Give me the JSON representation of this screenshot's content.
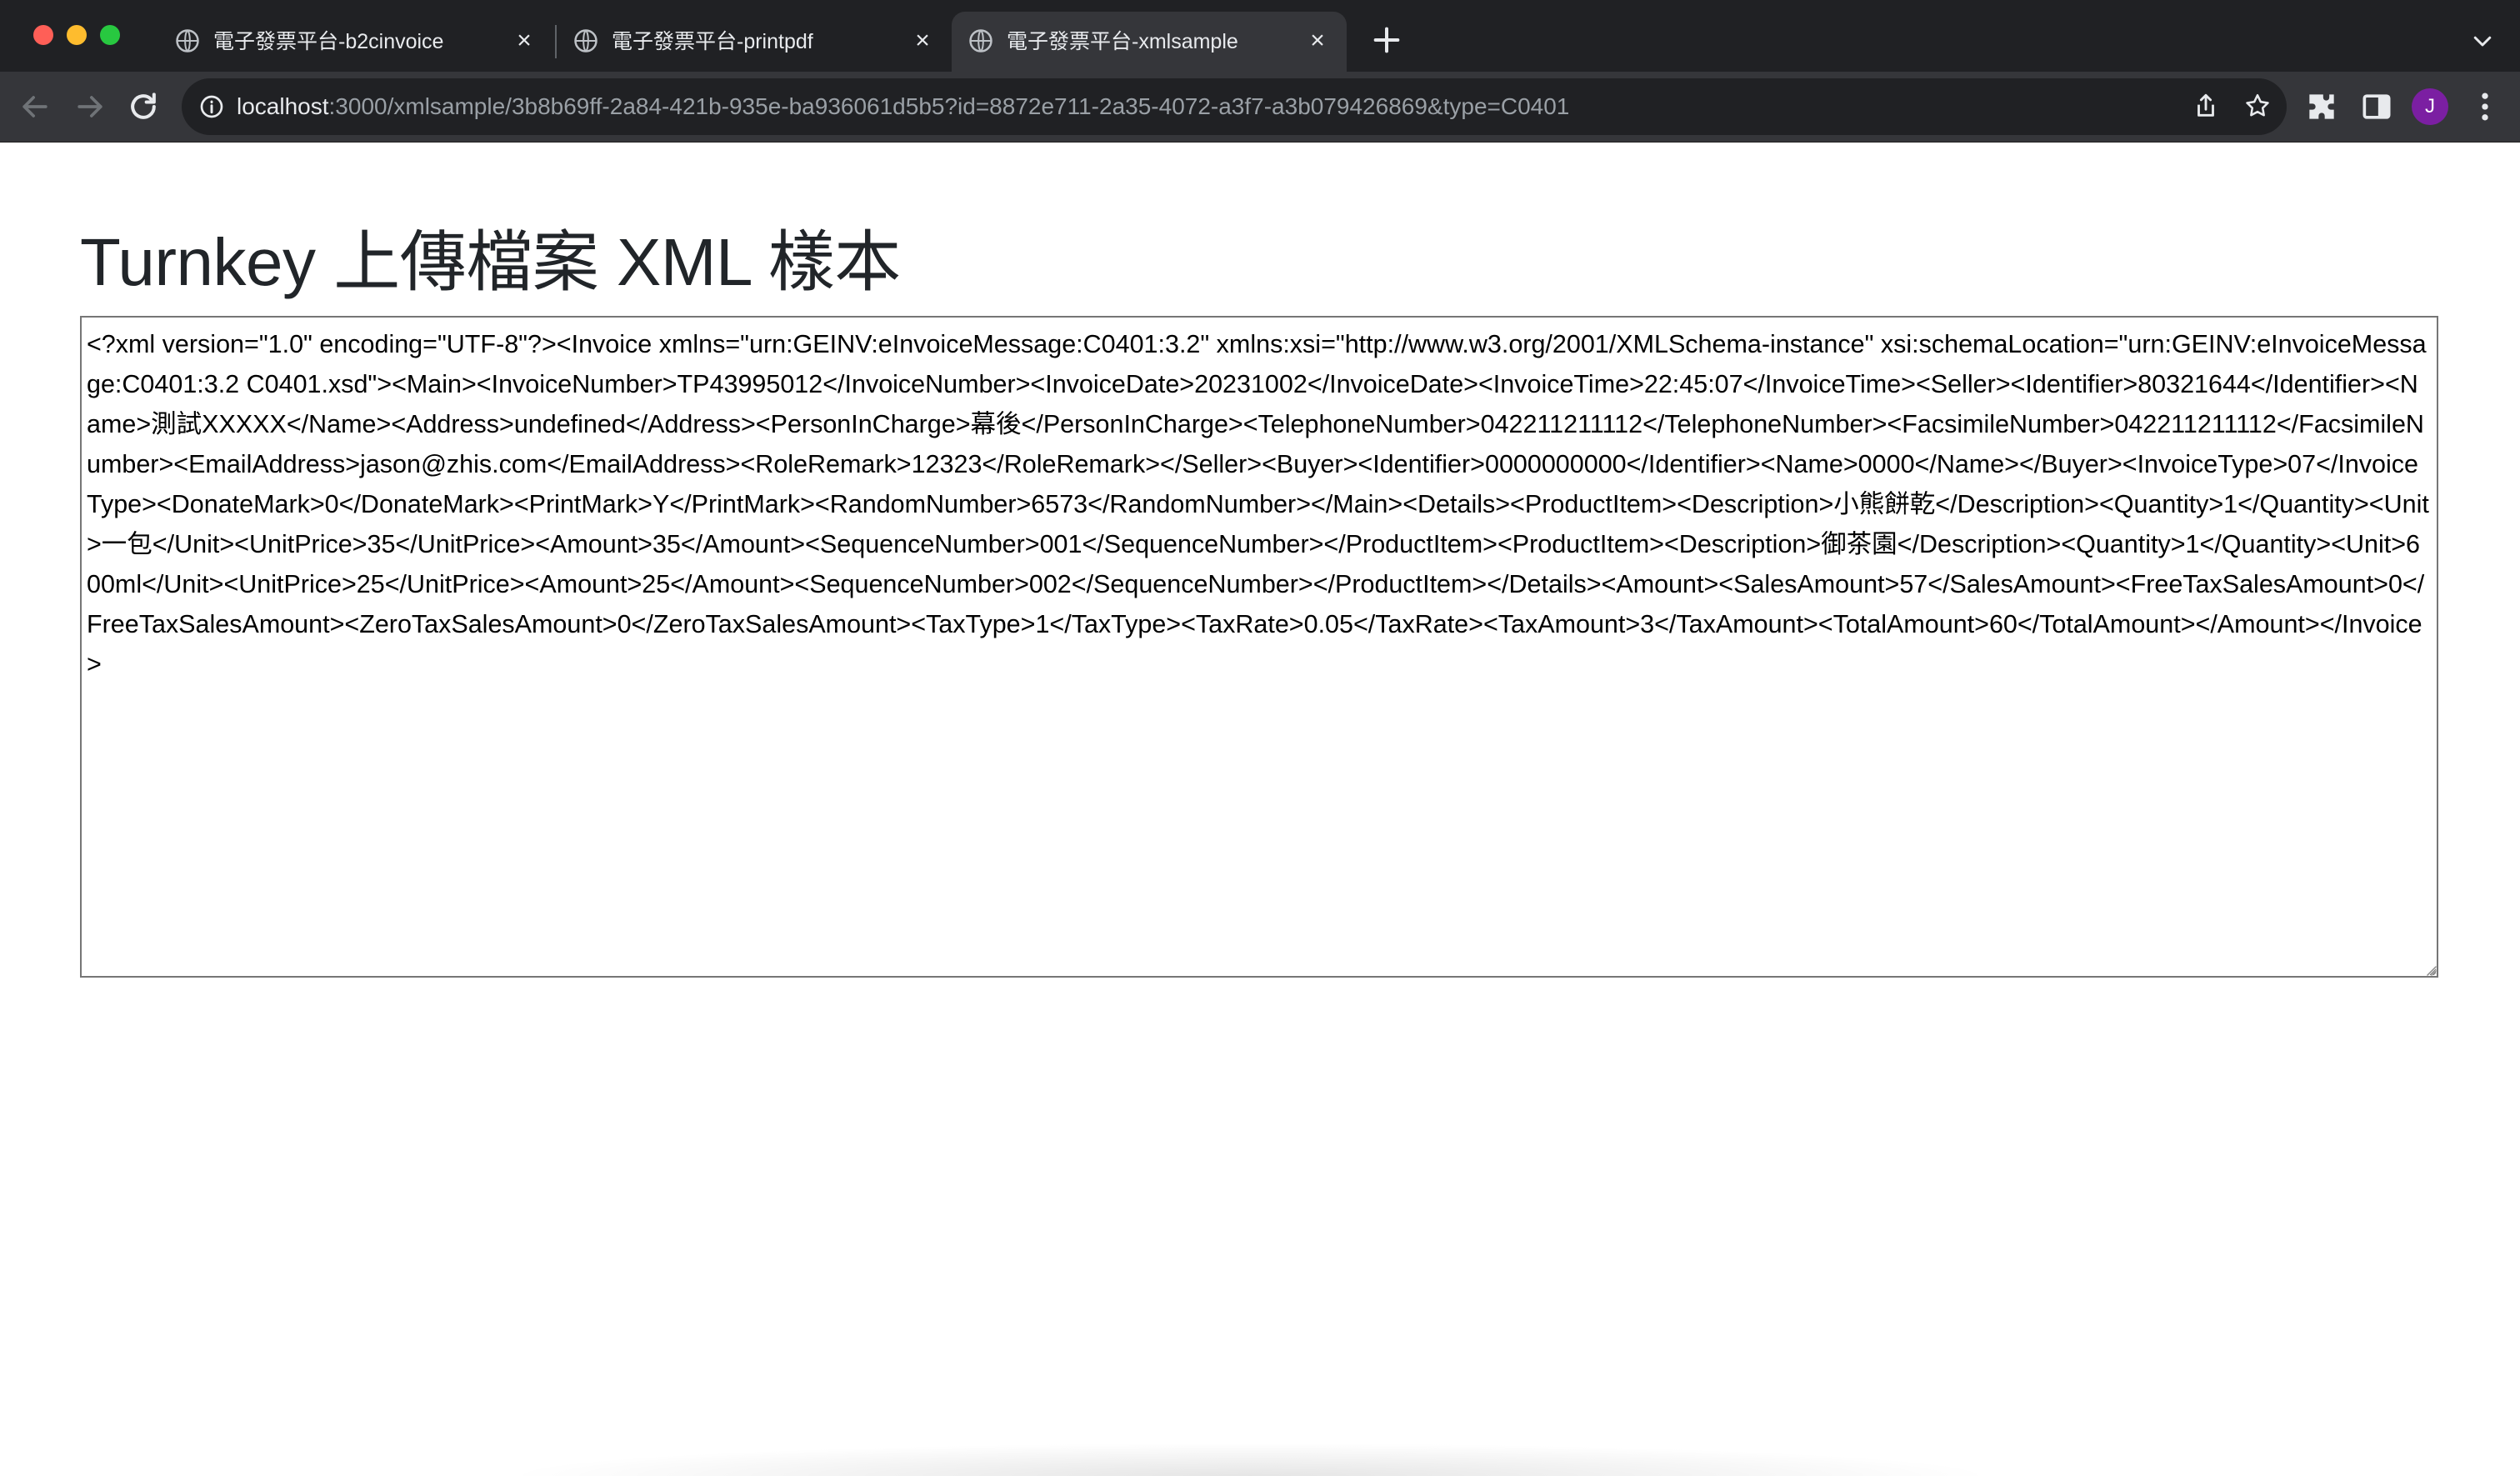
{
  "browser": {
    "tabs": [
      {
        "title": "電子發票平台-b2cinvoice",
        "icon": "globe-icon",
        "active": false
      },
      {
        "title": "電子發票平台-printpdf",
        "icon": "globe-icon",
        "active": false
      },
      {
        "title": "電子發票平台-xmlsample",
        "icon": "globe-icon",
        "active": true
      }
    ],
    "url_host": "localhost",
    "url_rest": ":3000/xmlsample/3b8b69ff-2a84-421b-935e-ba936061d5b5?id=8872e711-2a35-4072-a3f7-a3b079426869&type=C0401",
    "profile_initial": "J",
    "profile_color": "#7b1fa2"
  },
  "page": {
    "heading": "Turnkey 上傳檔案 XML 樣本",
    "xml_content": "<?xml version=\"1.0\" encoding=\"UTF-8\"?><Invoice xmlns=\"urn:GEINV:eInvoiceMessage:C0401:3.2\" xmlns:xsi=\"http://www.w3.org/2001/XMLSchema-instance\" xsi:schemaLocation=\"urn:GEINV:eInvoiceMessage:C0401:3.2 C0401.xsd\"><Main><InvoiceNumber>TP43995012</InvoiceNumber><InvoiceDate>20231002</InvoiceDate><InvoiceTime>22:45:07</InvoiceTime><Seller><Identifier>80321644</Identifier><Name>測試XXXXX</Name><Address>undefined</Address><PersonInCharge>幕後</PersonInCharge><TelephoneNumber>042211211112</TelephoneNumber><FacsimileNumber>042211211112</FacsimileNumber><EmailAddress>jason@zhis.com</EmailAddress><RoleRemark>12323</RoleRemark></Seller><Buyer><Identifier>0000000000</Identifier><Name>0000</Name></Buyer><InvoiceType>07</InvoiceType><DonateMark>0</DonateMark><PrintMark>Y</PrintMark><RandomNumber>6573</RandomNumber></Main><Details><ProductItem><Description>小熊餅乾</Description><Quantity>1</Quantity><Unit>一包</Unit><UnitPrice>35</UnitPrice><Amount>35</Amount><SequenceNumber>001</SequenceNumber></ProductItem><ProductItem><Description>御茶園</Description><Quantity>1</Quantity><Unit>600ml</Unit><UnitPrice>25</UnitPrice><Amount>25</Amount><SequenceNumber>002</SequenceNumber></ProductItem></Details><Amount><SalesAmount>57</SalesAmount><FreeTaxSalesAmount>0</FreeTaxSalesAmount><ZeroTaxSalesAmount>0</ZeroTaxSalesAmount><TaxType>1</TaxType><TaxRate>0.05</TaxRate><TaxAmount>3</TaxAmount><TotalAmount>60</TotalAmount></Amount></Invoice>"
  }
}
